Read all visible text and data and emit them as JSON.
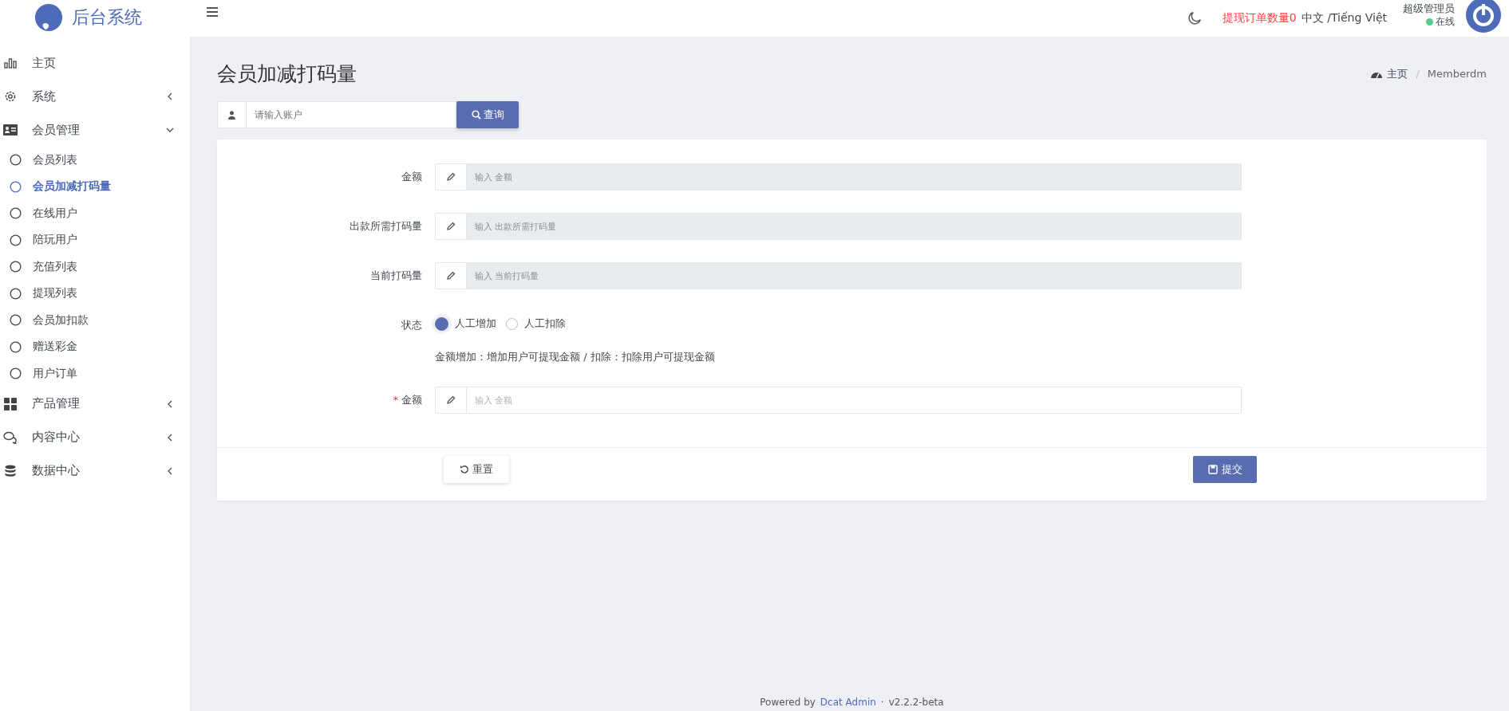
{
  "sidebar": {
    "logo_text": "后台系统",
    "items": [
      {
        "label": "主页"
      },
      {
        "label": "系统",
        "expanded": false
      },
      {
        "label": "会员管理",
        "expanded": true,
        "children": [
          {
            "label": "会员列表",
            "selected": false
          },
          {
            "label": "会员加减打码量",
            "selected": true
          },
          {
            "label": "在线用户",
            "selected": false
          },
          {
            "label": "陪玩用户",
            "selected": false
          },
          {
            "label": "充值列表",
            "selected": false
          },
          {
            "label": "提现列表",
            "selected": false
          },
          {
            "label": "会员加扣款",
            "selected": false
          },
          {
            "label": "赠送彩金",
            "selected": false
          },
          {
            "label": "用户订单",
            "selected": false
          }
        ]
      },
      {
        "label": "产品管理",
        "expanded": false
      },
      {
        "label": "内容中心",
        "expanded": false
      },
      {
        "label": "数据中心",
        "expanded": false
      }
    ]
  },
  "header": {
    "withdraw_notice": "提现订单数量0",
    "language": "中文 /Tiếng Việt",
    "user_name": "超级管理员",
    "user_status": "在线"
  },
  "page": {
    "title": "会员加减打码量",
    "breadcrumb": [
      "主页",
      "Memberdm"
    ],
    "breadcrumb_separator": "/"
  },
  "search": {
    "placeholder": "请输入账户",
    "button": "查询"
  },
  "form": {
    "fields": [
      {
        "kind": "text",
        "label": "金额",
        "placeholder": "输入 金额",
        "disabled": true
      },
      {
        "kind": "text",
        "label": "出款所需打码量",
        "placeholder": "输入 出款所需打码量",
        "disabled": true
      },
      {
        "kind": "text",
        "label": "当前打码量",
        "placeholder": "输入 当前打码量",
        "disabled": true
      },
      {
        "kind": "radio",
        "label": "状态",
        "options": [
          {
            "label": "人工增加",
            "selected": true
          },
          {
            "label": "人工扣除",
            "selected": false
          }
        ],
        "help": "金额增加：增加用户可提现金额 / 扣除：扣除用户可提现金额"
      },
      {
        "kind": "text",
        "label": "金额",
        "placeholder": "输入 金额",
        "disabled": false,
        "required_mark": "*"
      }
    ],
    "reset_button": "重置",
    "submit_button": "提交"
  },
  "footer": {
    "prefix": "Powered by",
    "link": "Dcat Admin",
    "separator": "·",
    "version": "v2.2.2-beta"
  }
}
